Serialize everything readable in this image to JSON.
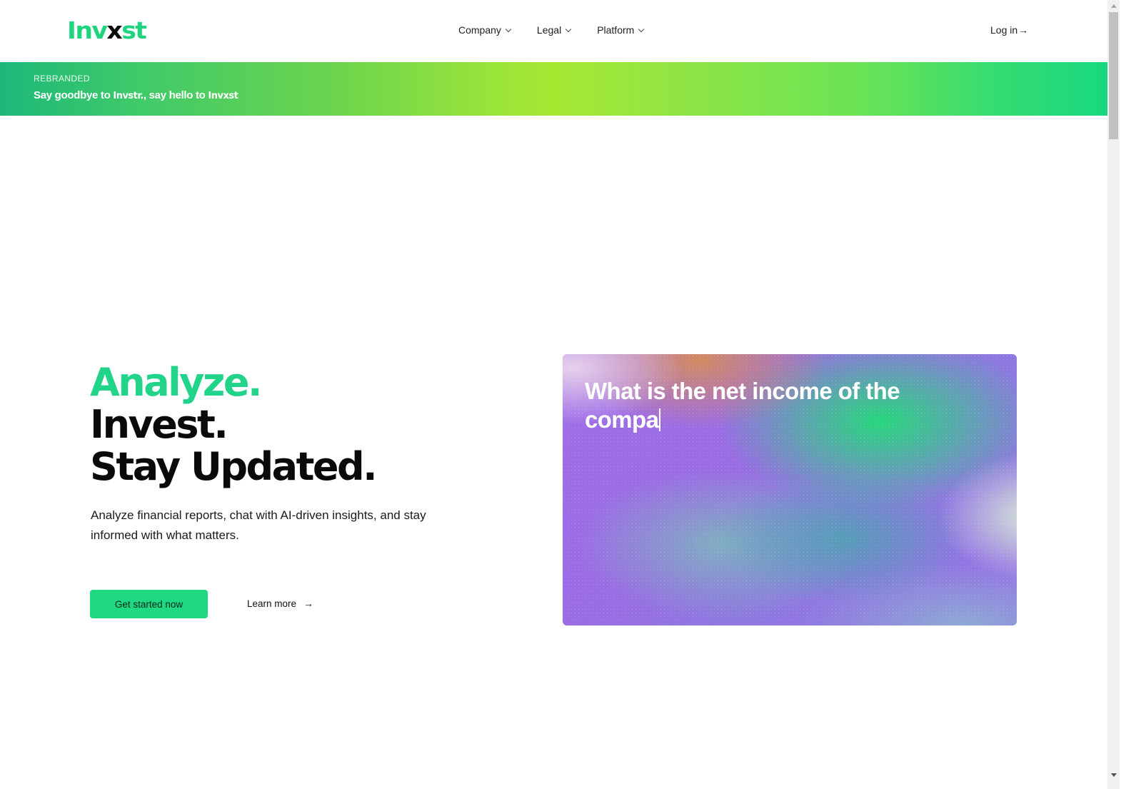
{
  "header": {
    "logo": {
      "part1": "Inv",
      "part2": "x",
      "part3": "st"
    },
    "nav": [
      {
        "label": "Company",
        "icon": "chevron-down-icon"
      },
      {
        "label": "Legal",
        "icon": "chevron-down-icon"
      },
      {
        "label": "Platform",
        "icon": "chevron-down-icon"
      }
    ],
    "login": {
      "label": "Log in",
      "icon": "→"
    }
  },
  "banner": {
    "tag": "REBRANDED",
    "text_before": "Say goodbye to ",
    "old_brand": "Invstr.",
    "text_middle": ", say hello to ",
    "new_brand": "Invxst"
  },
  "hero": {
    "title_line1": "Analyze.",
    "title_line2": "Invest.",
    "title_line3": "Stay Updated.",
    "subtitle": "Analyze financial reports, chat with AI-driven insights, and stay informed with what matters.",
    "primary_button": "Get started now",
    "secondary_link": "Learn more",
    "secondary_icon": "→"
  },
  "card": {
    "typed_text": "What is the net income of the compa"
  },
  "colors": {
    "brand_green": "#1fd47f",
    "heading_green": "#22d38a",
    "button_green": "#1fd882",
    "banner_mid": "#a6e832"
  }
}
